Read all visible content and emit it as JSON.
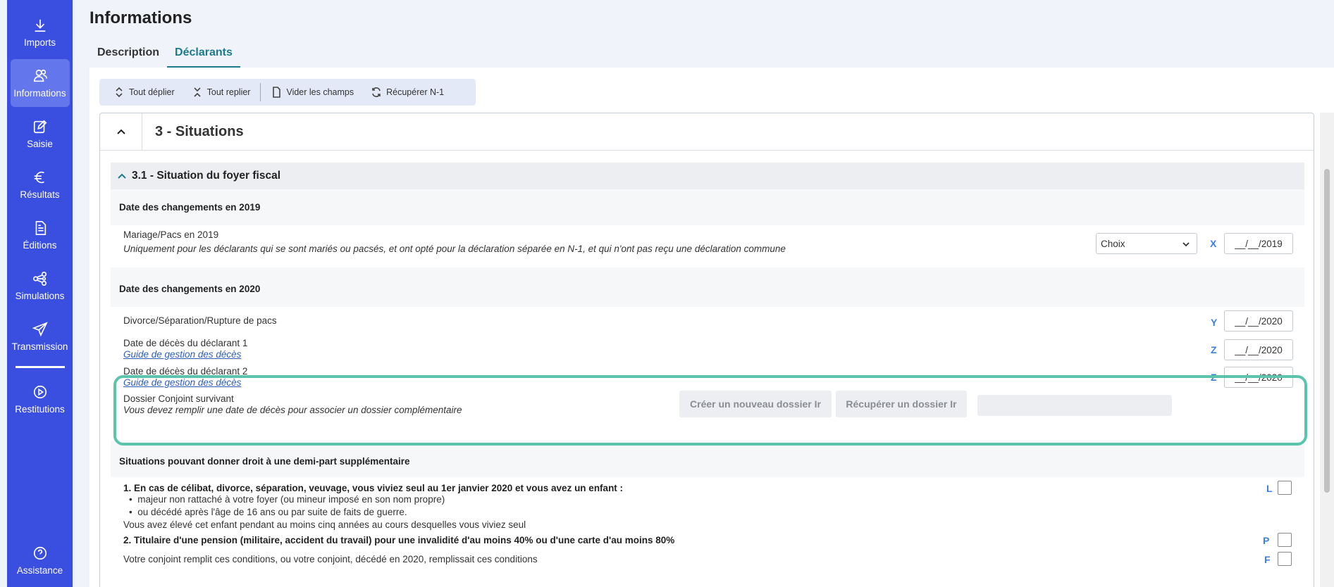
{
  "sidebar": {
    "items": [
      {
        "label": "Imports",
        "icon": "download-icon"
      },
      {
        "label": "Informations",
        "icon": "users-icon"
      },
      {
        "label": "Saisie",
        "icon": "edit-icon"
      },
      {
        "label": "Résultats",
        "icon": "euro-icon"
      },
      {
        "label": "Éditions",
        "icon": "document-icon"
      },
      {
        "label": "Simulations",
        "icon": "network-icon"
      },
      {
        "label": "Transmission",
        "icon": "send-icon"
      },
      {
        "label": "Restitutions",
        "icon": "play-icon"
      }
    ],
    "assistance": "Assistance",
    "accent": "#3a4fe0"
  },
  "page": {
    "title": "Informations",
    "tabs": [
      "Description",
      "Déclarants"
    ]
  },
  "toolbar": {
    "expand_all": "Tout déplier",
    "collapse_all": "Tout replier",
    "clear_fields": "Vider les champs",
    "fetch_previous": "Récupérer N-1"
  },
  "section": {
    "title": "3 - Situations",
    "subsection_title": "3.1 - Situation du foyer fiscal",
    "group_2019": "Date des changements en 2019",
    "mariage_label": "Mariage/Pacs en 2019",
    "mariage_help": "Uniquement pour les déclarants qui se sont mariés ou pacsés, et ont opté pour la déclaration séparée en N-1, et qui n'ont pas reçu une déclaration commune",
    "mariage_select": "Choix",
    "mariage_code": "X",
    "mariage_date": "__/__/2019",
    "group_2020": "Date des changements en 2020",
    "divorce_label": "Divorce/Séparation/Rupture de pacs",
    "divorce_code": "Y",
    "divorce_date": "__/__/2020",
    "deces1_label": "Date de décès du déclarant 1",
    "deces1_link": "Guide de gestion des décès",
    "deces1_code": "Z",
    "deces1_date": "__/__/2020",
    "deces2_label": "Date de décès du déclarant 2",
    "deces2_link": "Guide de gestion des décès",
    "deces2_code": "Z",
    "deces2_date": "__/__/2020",
    "conjoint_label": "Dossier Conjoint survivant",
    "conjoint_help": "Vous devez remplir une date de décès pour associer un dossier complémentaire",
    "create_btn": "Créer un nouveau dossier Ir",
    "fetch_btn": "Récupérer un dossier Ir",
    "group_demi_part": "Situations pouvant donner droit à une demi-part supplémentaire",
    "case1_title": "1. En cas de célibat, divorce, séparation, veuvage, vous viviez seul au 1er janvier 2020 et vous avez un enfant :",
    "case1_bullet1": "majeur non rattaché à votre foyer (ou mineur imposé en son nom propre)",
    "case1_bullet2": "ou décédé après l'âge de 16 ans ou par suite de faits de guerre.",
    "case1_note": "Vous avez élevé cet enfant pendant au moins cinq années au cours desquelles vous viviez seul",
    "case1_code": "L",
    "case2_title": "2. Titulaire d'une pension (militaire, accident du travail) pour une invalidité d'au moins 40% ou d'une carte d'au moins 80%",
    "case2_code": "P",
    "case2_note": "Votre conjoint remplit ces conditions, ou votre conjoint, décédé en 2020, remplissait ces conditions",
    "case2_code2": "F"
  },
  "colors": {
    "highlight": "#5cc4ad",
    "code": "#3a80e0",
    "link": "#2f5fb8",
    "tab_active": "#1d7a8c"
  }
}
